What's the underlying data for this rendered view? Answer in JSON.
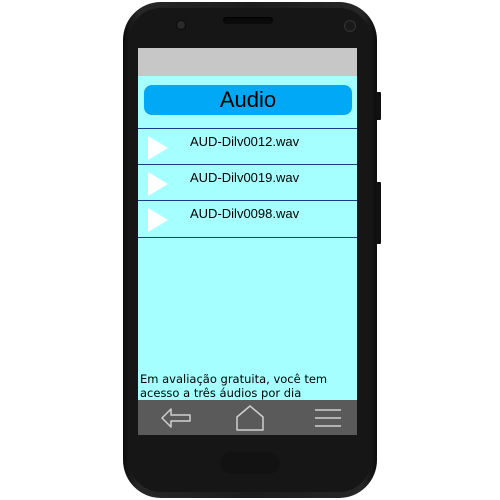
{
  "app": {
    "title": "Audio"
  },
  "audio_files": [
    {
      "name": "AUD-Dilv0012.wav",
      "icon": "play-icon"
    },
    {
      "name": "AUD-Dilv0019.wav",
      "icon": "play-icon"
    },
    {
      "name": "AUD-Dilv0098.wav",
      "icon": "play-icon"
    }
  ],
  "notice": {
    "text": "Em avaliação gratuita, você tem acesso a três áudios por dia"
  },
  "nav": {
    "back_icon": "back-arrow-icon",
    "home_icon": "home-icon",
    "menu_icon": "menu-icon"
  },
  "colors": {
    "screen_background": "#a6ffff",
    "title_bar": "#00a8f5",
    "status_bar": "#c7c7c7",
    "nav_bar": "#5a5a5a",
    "row_divider": "#1c3c8c"
  }
}
